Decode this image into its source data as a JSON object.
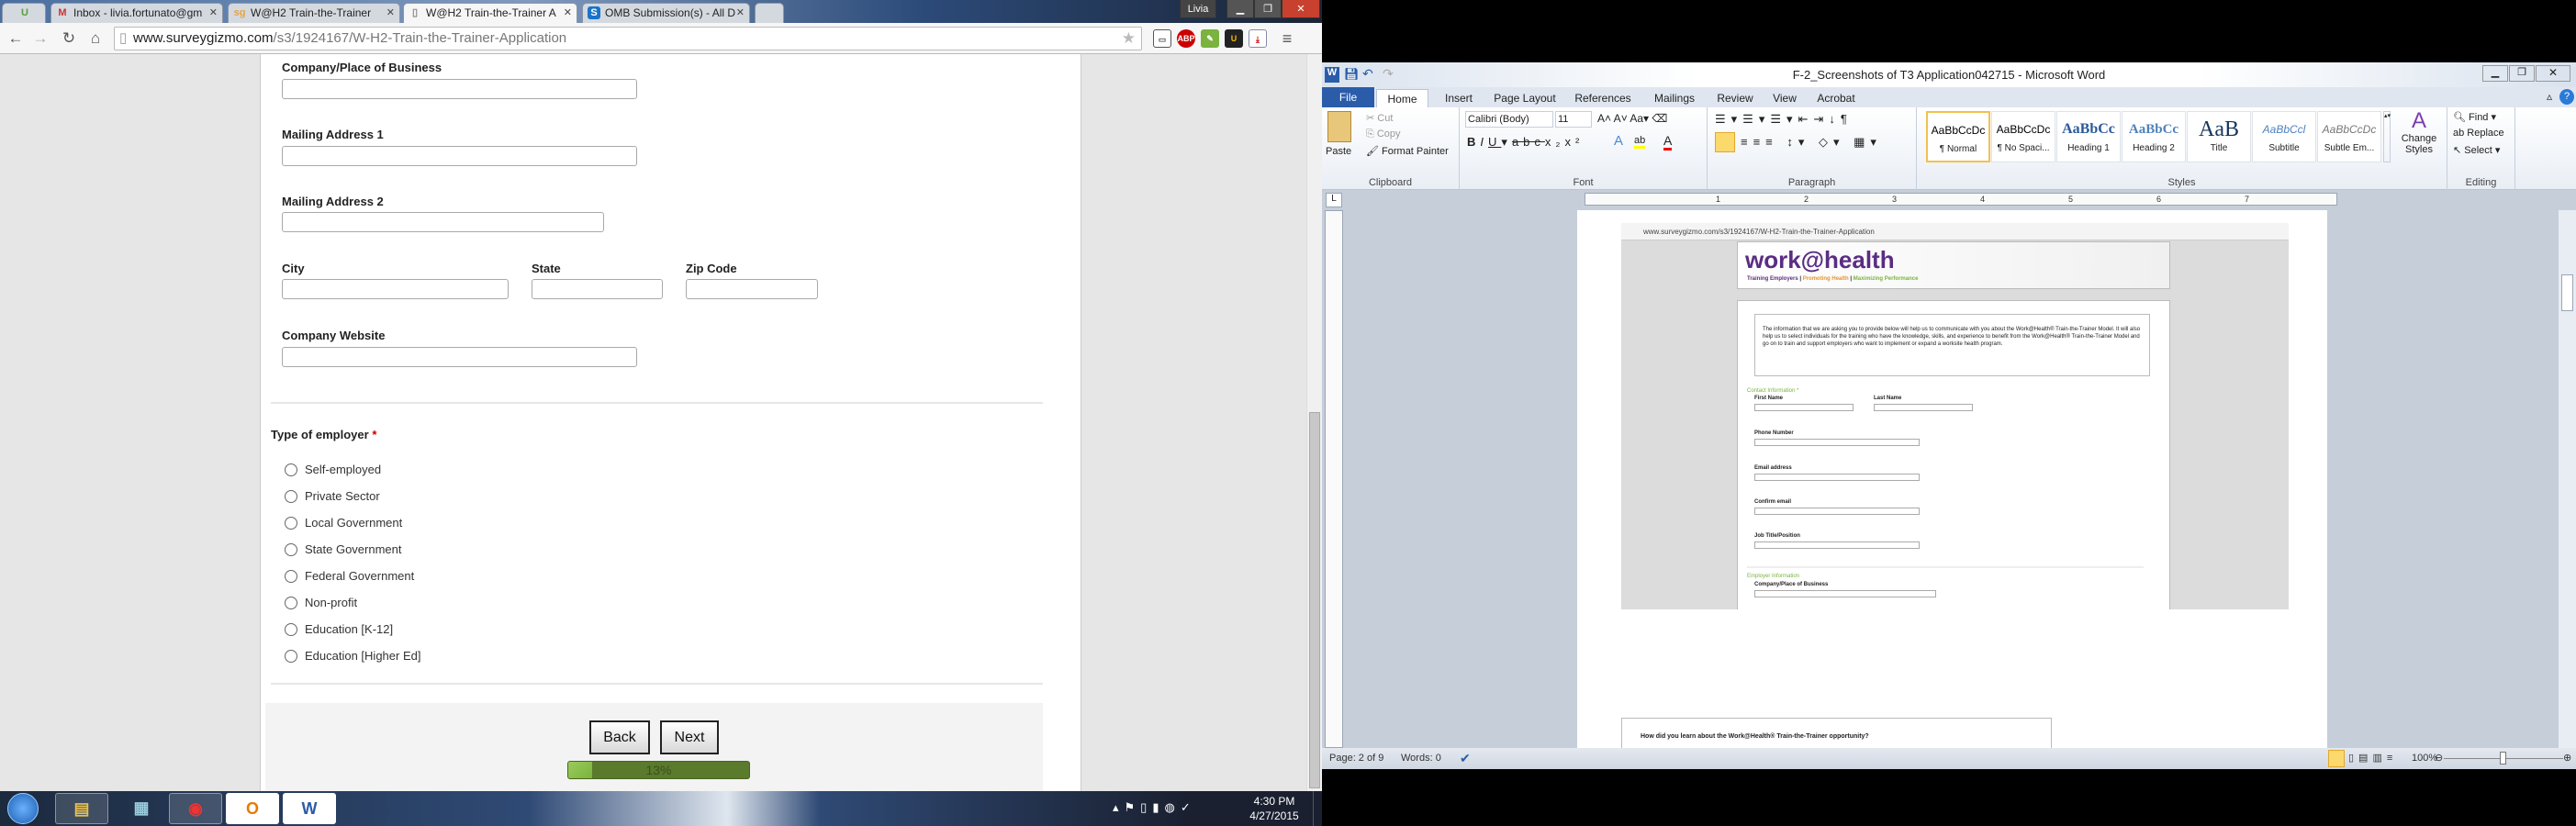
{
  "browser": {
    "tabs": [
      {
        "label": "",
        "icon": "pinned-app-icon"
      },
      {
        "label": "Inbox - livia.fortunato@gm",
        "icon": "gmail-icon"
      },
      {
        "label": "W@H2 Train-the-Trainer",
        "icon": "surveygizmo-icon"
      },
      {
        "label": "W@H2 Train-the-Trainer A",
        "icon": "page-icon"
      },
      {
        "label": "OMB Submission(s) - All D",
        "icon": "sharepoint-icon"
      }
    ],
    "user": "Livia",
    "url_host": "www.surveygizmo.com",
    "url_path": "/s3/1924167/W-H2-Train-the-Trainer-Application",
    "extensions": [
      "ABP",
      "U"
    ]
  },
  "form": {
    "company_label": "Company/Place of Business",
    "address1_label": "Mailing Address 1",
    "address2_label": "Mailing Address 2",
    "city_label": "City",
    "state_label": "State",
    "zip_label": "Zip Code",
    "website_label": "Company Website",
    "employer_type_label": "Type of employer",
    "required_mark": "*",
    "employer_types": [
      "Self-employed",
      "Private Sector",
      "Local Government",
      "State Government",
      "Federal Government",
      "Non-profit",
      "Education [K-12]",
      "Education [Higher Ed]"
    ],
    "back_label": "Back",
    "next_label": "Next",
    "progress_text": "13%",
    "progress_value": 13
  },
  "taskbar": {
    "time": "4:30 PM",
    "date": "4/27/2015"
  },
  "word": {
    "title": "F-2_Screenshots of T3 Application042715 - Microsoft Word",
    "tabs": [
      "File",
      "Home",
      "Insert",
      "Page Layout",
      "References",
      "Mailings",
      "Review",
      "View",
      "Acrobat"
    ],
    "clipboard": {
      "paste": "Paste",
      "cut": "Cut",
      "copy": "Copy",
      "format_painter": "Format Painter",
      "group": "Clipboard"
    },
    "font": {
      "name": "Calibri (Body)",
      "size": "11",
      "group": "Font"
    },
    "paragraph": {
      "group": "Paragraph"
    },
    "styles": {
      "items": [
        {
          "preview": "AaBbCcDc",
          "name": "¶ Normal"
        },
        {
          "preview": "AaBbCcDc",
          "name": "¶ No Spaci..."
        },
        {
          "preview": "AaBbCc",
          "name": "Heading 1"
        },
        {
          "preview": "AaBbCc",
          "name": "Heading 2"
        },
        {
          "preview": "AaB",
          "name": "Title"
        },
        {
          "preview": "AaBbCcl",
          "name": "Subtitle"
        },
        {
          "preview": "AaBbCcDc",
          "name": "Subtle Em..."
        }
      ],
      "change_styles": "Change Styles",
      "group": "Styles"
    },
    "editing": {
      "find": "Find",
      "replace": "Replace",
      "select": "Select",
      "group": "Editing"
    },
    "ruler_numbers": [
      "1",
      "2",
      "3",
      "4",
      "5",
      "6",
      "7"
    ],
    "status": {
      "page": "Page: 2 of 9",
      "words": "Words: 0",
      "zoom": "100%"
    }
  },
  "embedded": {
    "url": "www.surveygizmo.com/s3/1924167/W-H2-Train-the-Trainer-Application",
    "logo": "work@health",
    "tagline_1": "Training Employers",
    "tagline_2": "Promoting Health",
    "tagline_3": "Maximizing Performance",
    "intro": "The information that we are asking you to provide below will help us to communicate with you about the Work@Health® Train-the-Trainer Model.  It will also help us to select individuals for the training who have the knowledge, skills, and experience to benefit from the Work@Health® Train-the-Trainer Model and go on to train and support employers who want to implement or expand a worksite health program.",
    "contact_section": "Contact Information *",
    "first_name": "First Name",
    "last_name": "Last Name",
    "phone": "Phone Number",
    "email": "Email address",
    "confirm_email": "Confirm email",
    "job_title": "Job Title/Position",
    "employer_section": "Employer Information",
    "company": "Company/Place of Business",
    "question": "How did you learn about the Work@Health® Train-the-Trainer opportunity?"
  },
  "colors": {
    "accent_green": "#7ab33d",
    "required_red": "#cc0000",
    "word_file_blue": "#2a5caa"
  }
}
